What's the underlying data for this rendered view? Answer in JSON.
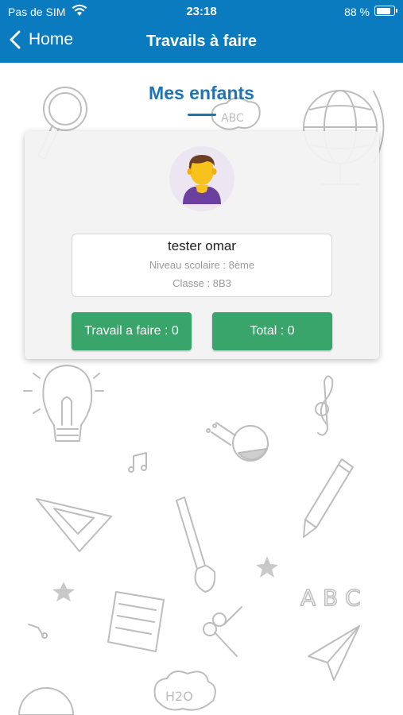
{
  "status_bar": {
    "carrier": "Pas de SIM",
    "time": "23:18",
    "battery_percent": "88 %",
    "battery_level": 0.88
  },
  "nav": {
    "back_label": "Home",
    "title": "Travails à faire"
  },
  "section": {
    "title": "Mes enfants"
  },
  "child": {
    "name": "tester omar",
    "niveau": "Niveau scolaire : 8ème",
    "classe": "Classe : 8B3",
    "work_button": "Travail a faire : 0",
    "total_button": "Total : 0"
  },
  "colors": {
    "header": "#0b7bbf",
    "accent": "#1d74b4",
    "button": "#3aa56b"
  },
  "doodles": {
    "abc_top": "ABC",
    "abc_bottom": "A B C",
    "h2o": "H2O"
  }
}
